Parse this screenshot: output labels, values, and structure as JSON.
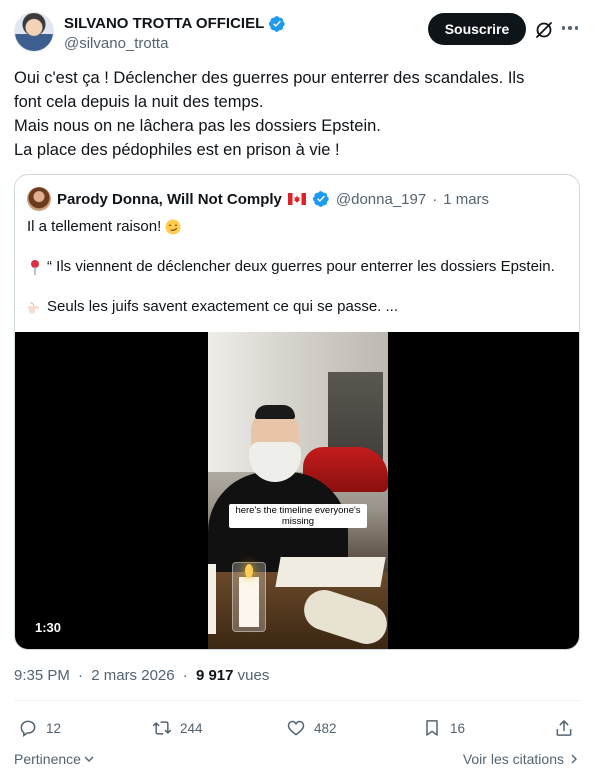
{
  "author": {
    "name": "SILVANO TROTTA OFFICIEL",
    "handle": "@silvano_trotta"
  },
  "header": {
    "subscribe_label": "Souscrire"
  },
  "tweet": {
    "lines": [
      "Oui c'est ça ! Déclencher des guerres pour enterrer des scandales. Ils",
      "font cela depuis la nuit des temps.",
      "Mais nous on ne lâchera pas les dossiers Epstein.",
      "La place des pédophiles est en prison à vie !"
    ]
  },
  "quote": {
    "name": "Parody Donna, Will Not Comply",
    "handle": "@donna_197",
    "separator": "·",
    "date": "1 mars",
    "line1": "Il a tellement raison!",
    "line2": "“ Ils viennent de déclencher deux guerres pour enterrer les dossiers Epstein.",
    "line3": "Seuls les juifs savent exactement ce qui se passe. ...",
    "video": {
      "caption": "here's the timeline everyone's missing",
      "duration": "1:30"
    }
  },
  "meta": {
    "time": "9:35 PM",
    "separator": "·",
    "date": "2 mars 2026",
    "views_count": "9 917",
    "views_label": "vues"
  },
  "actions": {
    "replies": "12",
    "reposts": "244",
    "likes": "482",
    "bookmarks": "16"
  },
  "footer": {
    "sort_label": "Pertinence",
    "quotes_label": "Voir les citations"
  },
  "colors": {
    "text": "#0f1419",
    "secondary": "#536471",
    "verified": "#1d9bf0",
    "button": "#0f1419",
    "border": "#cfd9de"
  }
}
